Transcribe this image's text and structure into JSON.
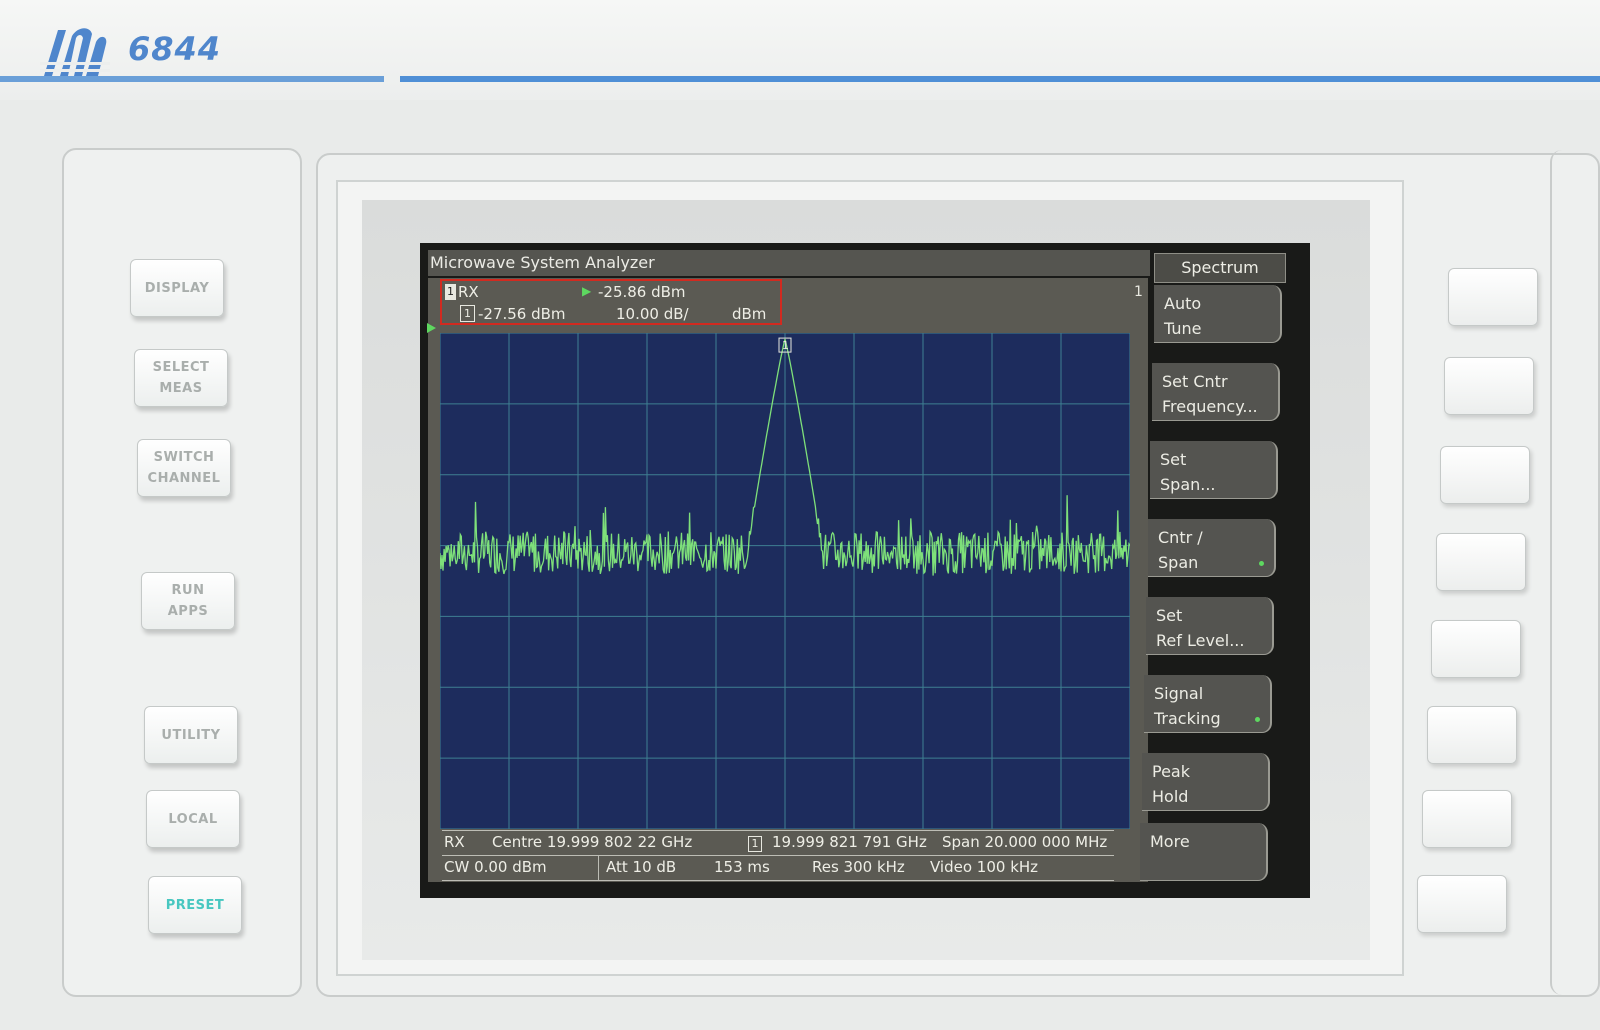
{
  "brand": {
    "model": "6844"
  },
  "hard_keys": [
    {
      "label": "DISPLAY"
    },
    {
      "label": "SELECT\nMEAS"
    },
    {
      "label": "SWITCH\nCHANNEL"
    },
    {
      "label": "RUN\nAPPS"
    },
    {
      "label": "UTILITY"
    },
    {
      "label": "LOCAL"
    },
    {
      "label": "PRESET"
    }
  ],
  "screen": {
    "title": "Microwave System Analyzer",
    "trace_number": "1",
    "info": {
      "badge": "1",
      "channel": "RX",
      "ref_level": "-25.86 dBm",
      "marker_id": "1",
      "marker_value": "-27.56 dBm",
      "scale": "10.00 dB/",
      "unit": "dBm"
    },
    "status_row1": {
      "channel": "RX",
      "centre": "Centre 19.999 802 22 GHz",
      "marker_id": "1",
      "marker_freq": "19.999 821 791 GHz",
      "span": "Span 20.000 000 MHz"
    },
    "status_row2": {
      "cw": "CW 0.00 dBm",
      "att": "Att 10 dB",
      "sweep": "153 ms",
      "res": "Res 300 kHz",
      "video": "Video 100 kHz"
    },
    "softkeys": {
      "header": "Spectrum",
      "items": [
        {
          "label": "Auto\nTune"
        },
        {
          "label": "Set Cntr\nFrequency..."
        },
        {
          "label": "Set\nSpan..."
        },
        {
          "label": "Cntr /\nSpan"
        },
        {
          "label": "Set\nRef Level..."
        },
        {
          "label": "Signal\nTracking"
        },
        {
          "label": "Peak\nHold"
        },
        {
          "label": "More"
        }
      ]
    }
  },
  "chart_data": {
    "type": "line",
    "xlabel": "",
    "ylabel": "",
    "ylim": [
      -95,
      -25
    ],
    "grid": true,
    "trace_color": "#7ee07a",
    "background": "#1d2c5d",
    "peak": {
      "x": 0.0,
      "y": -25.86
    },
    "noise_floor": -56,
    "xlim": [
      -10,
      10
    ],
    "x_unit": "MHz offset from centre",
    "series": [
      {
        "values_note": "noise floor around -56 dBm with single peak at marker 1"
      }
    ]
  }
}
